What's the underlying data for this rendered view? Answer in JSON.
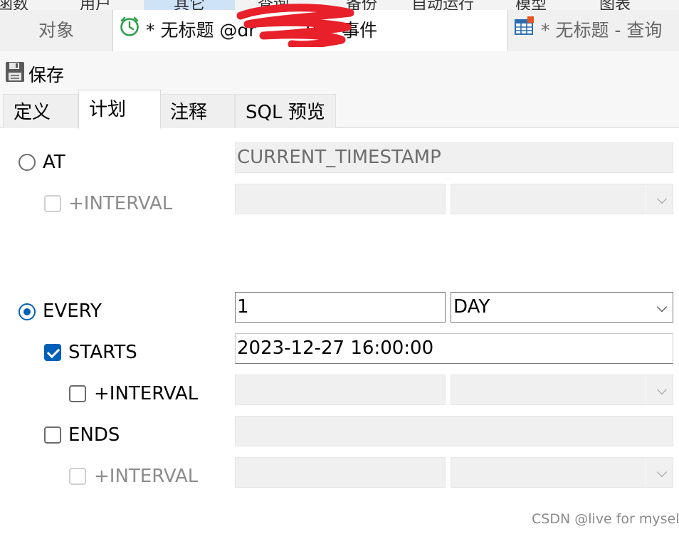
{
  "menu": {
    "items": [
      "函数",
      "用户",
      "其它",
      "查询",
      "备份",
      "自动运行",
      "模型",
      "图表"
    ]
  },
  "doc_tabs": [
    {
      "label": "对象"
    },
    {
      "label": "* 无标题 @dr",
      "suffix": "0) - 事件",
      "icon": "clock-icon"
    },
    {
      "label": "* 无标题 - 查询",
      "icon": "table-icon"
    }
  ],
  "toolbar": {
    "save_label": "保存",
    "save_icon": "floppy-disk-icon"
  },
  "editor_tabs": [
    {
      "label": "定义"
    },
    {
      "label": "计划"
    },
    {
      "label": "注释"
    },
    {
      "label": "SQL 预览"
    }
  ],
  "schedule": {
    "at": {
      "label": "AT",
      "selected": false,
      "value": "CURRENT_TIMESTAMP",
      "interval": {
        "label": "+INTERVAL",
        "checked": false,
        "enabled": false,
        "value": "",
        "unit": ""
      }
    },
    "every": {
      "label": "EVERY",
      "selected": true,
      "value": "1",
      "unit": "DAY",
      "starts": {
        "label": "STARTS",
        "checked": true,
        "value": "2023-12-27  16:00:00",
        "interval": {
          "label": "+INTERVAL",
          "checked": false,
          "enabled": true,
          "value": "",
          "unit": ""
        }
      },
      "ends": {
        "label": "ENDS",
        "checked": false,
        "value": "",
        "interval": {
          "label": "+INTERVAL",
          "checked": false,
          "enabled": false,
          "value": "",
          "unit": ""
        }
      }
    }
  },
  "watermark": "CSDN @live for myself",
  "colors": {
    "accent": "#005fb8",
    "redaction": "#e8202a"
  }
}
